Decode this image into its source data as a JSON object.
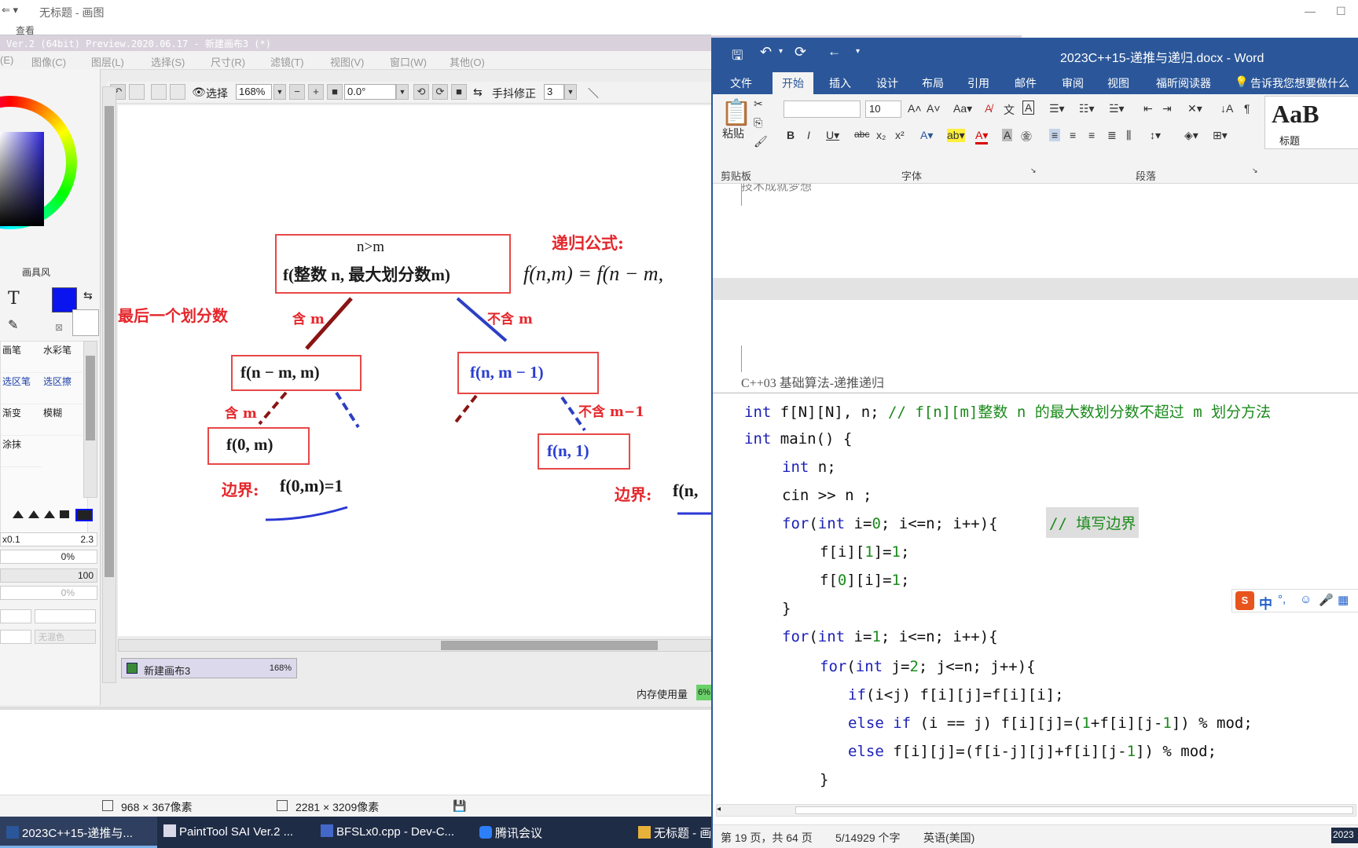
{
  "paint": {
    "title": "无标题 - 画图",
    "tab_partial": "查看"
  },
  "sai": {
    "title": "Ver.2 (64bit) Preview.2020.06.17 - 新建画布3 (*)",
    "menu": [
      "图像(C)",
      "图层(L)",
      "选择(S)",
      "尺寸(R)",
      "滤镜(T)",
      "视图(V)",
      "窗口(W)",
      "其他(O)"
    ],
    "menu_partial_first": "(E)",
    "toolbar": {
      "select_label": "选择",
      "zoom": "168%",
      "angle": "0.0°",
      "stabilizer_label": "手抖修正",
      "stabilizer_value": "3"
    },
    "left_panel": {
      "brush_label": "画具风",
      "tools": [
        "画笔",
        "水彩笔",
        "选区笔",
        "选区擦",
        "渐变",
        "模糊",
        "涂抹"
      ],
      "size_min": "x0.1",
      "size_value": "2.3",
      "density_label": "0%",
      "opacity_value": "100",
      "blend_label": "0%",
      "blend_placeholder": "无混色"
    },
    "canvas": {
      "box_top_line1": "n>m",
      "box_top_line2": "f(整数 n, 最大划分数m)",
      "formula_label": "递归公式:",
      "formula": "f(n,m) = f(n − m,",
      "left_note": "最后一个划分数",
      "branch_left": "含 m",
      "branch_right": "不含 m",
      "node_left": "f(n − m, m)",
      "node_right": "f(n, m − 1)",
      "branch_left2": "含 m",
      "branch_right2": "不含 m−1",
      "leaf_left": "f(0, m)",
      "leaf_right": "f(n, 1)",
      "boundary_left_label": "边界:",
      "boundary_left": "f(0,m)=1",
      "boundary_right_label": "边界:",
      "boundary_right": "f(n,"
    },
    "canvas_tab": {
      "name": "新建画布3",
      "zoom": "168%"
    },
    "memory_label": "内存使用量",
    "memory_value": "6%",
    "status": {
      "view_size": "968 × 367像素",
      "canvas_size": "2281 × 3209像素"
    }
  },
  "word": {
    "title": "2023C++15-递推与递归.docx - Word",
    "tabs": [
      "文件",
      "开始",
      "插入",
      "设计",
      "布局",
      "引用",
      "邮件",
      "审阅",
      "视图",
      "福昕阅读器"
    ],
    "active_tab": "开始",
    "tell_me": "告诉我您想要做什么",
    "ribbon": {
      "paste": "粘贴",
      "clipboard": "剪贴板",
      "font_size": "10",
      "font_group": "字体",
      "paragraph_group": "段落",
      "style_preview": "AaB",
      "style_name": "标题"
    },
    "doc": {
      "prev_page_text": "技术成就梦想",
      "header_text": "C++03 基础算法-递推递归",
      "code_lines": [
        "int f[N][N], n;   // f[n][m]整数 n 的最大数划分数不超过 m 划分方法",
        "int main() {",
        "int n;",
        "cin >> n ;",
        "for(int i=0; i<=n; i++){",
        "// 填写边界",
        "f[i][1]=1;",
        "f[0][i]=1;",
        "}",
        "for(int i=1; i<=n; i++){",
        "for(int j=2; j<=n; j++){",
        "if(i<j) f[i][j]=f[i][i];",
        "else if (i == j) f[i][j]=(1+f[i][j-1]) % mod;",
        "else f[i][j]=(f[i-j][j]+f[i][j-1]) % mod;",
        "}"
      ],
      "ime_label": "中"
    },
    "status": {
      "page": "第 19 页，共 64 页",
      "words": "5/14929 个字",
      "lang": "英语(美国)"
    }
  },
  "taskbar": {
    "items": [
      "2023C++15-递推与...",
      "PaintTool SAI Ver.2 ...",
      "BFSLx0.cpp - Dev-C...",
      "腾讯会议",
      "无标题 - 画"
    ],
    "tray_partial": "2023"
  },
  "colors": {
    "word_blue": "#2b579a",
    "sai_primary": "#0a14ee",
    "diagram_red": "#e5262b",
    "taskbar": "#1f2c46"
  }
}
